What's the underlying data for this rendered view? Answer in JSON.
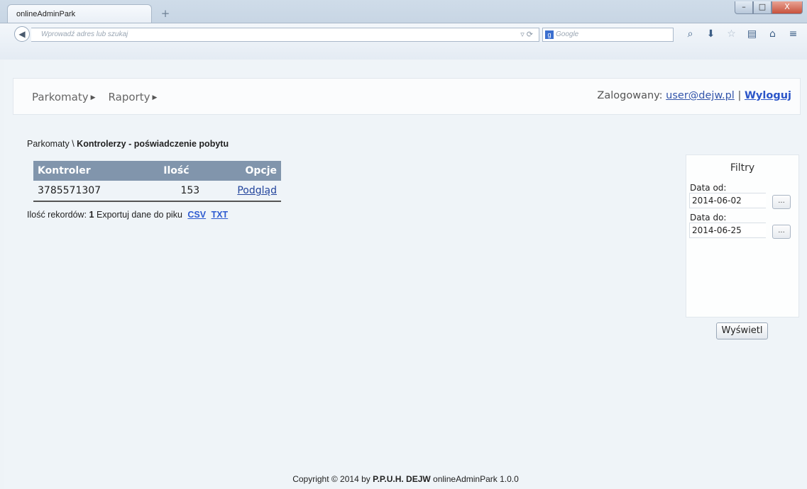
{
  "browser": {
    "tab_title": "onlineAdminPark",
    "new_tab_icon": "+",
    "address_placeholder": "Wprowadź adres lub szukaj",
    "search_placeholder": "Google",
    "window_controls": [
      "–",
      "□",
      "X"
    ]
  },
  "nav": {
    "menu": [
      "Parkomaty",
      "Raporty"
    ],
    "logged_in_label": "Zalogowany:",
    "user_email": "user@dejw.pl",
    "separator": "|",
    "logout": "Wyloguj"
  },
  "breadcrumb": {
    "root": "Parkomaty \\",
    "current": "Kontrolerzy - poświadczenie pobytu"
  },
  "table": {
    "columns": [
      "Kontroler",
      "Ilość",
      "Opcje"
    ],
    "rows": [
      {
        "kontroler": "3785571307",
        "ilosc": "153",
        "opcje": "Podgląd"
      }
    ]
  },
  "records": {
    "label": "Ilość rekordów:",
    "count": "1",
    "export_label": "Exportuj dane do piku",
    "csv": "CSV",
    "txt": "TXT"
  },
  "filters": {
    "title": "Filtry",
    "date_from_label": "Data od:",
    "date_from_value": "2014-06-02",
    "date_to_label": "Data do:",
    "date_to_value": "2014-06-25",
    "picker_label": "...",
    "show_button": "Wyświetl"
  },
  "footer": {
    "prefix": "Copyright © 2014 by",
    "company": "P.P.U.H. DEJW",
    "suffix": "onlineAdminPark 1.0.0"
  }
}
